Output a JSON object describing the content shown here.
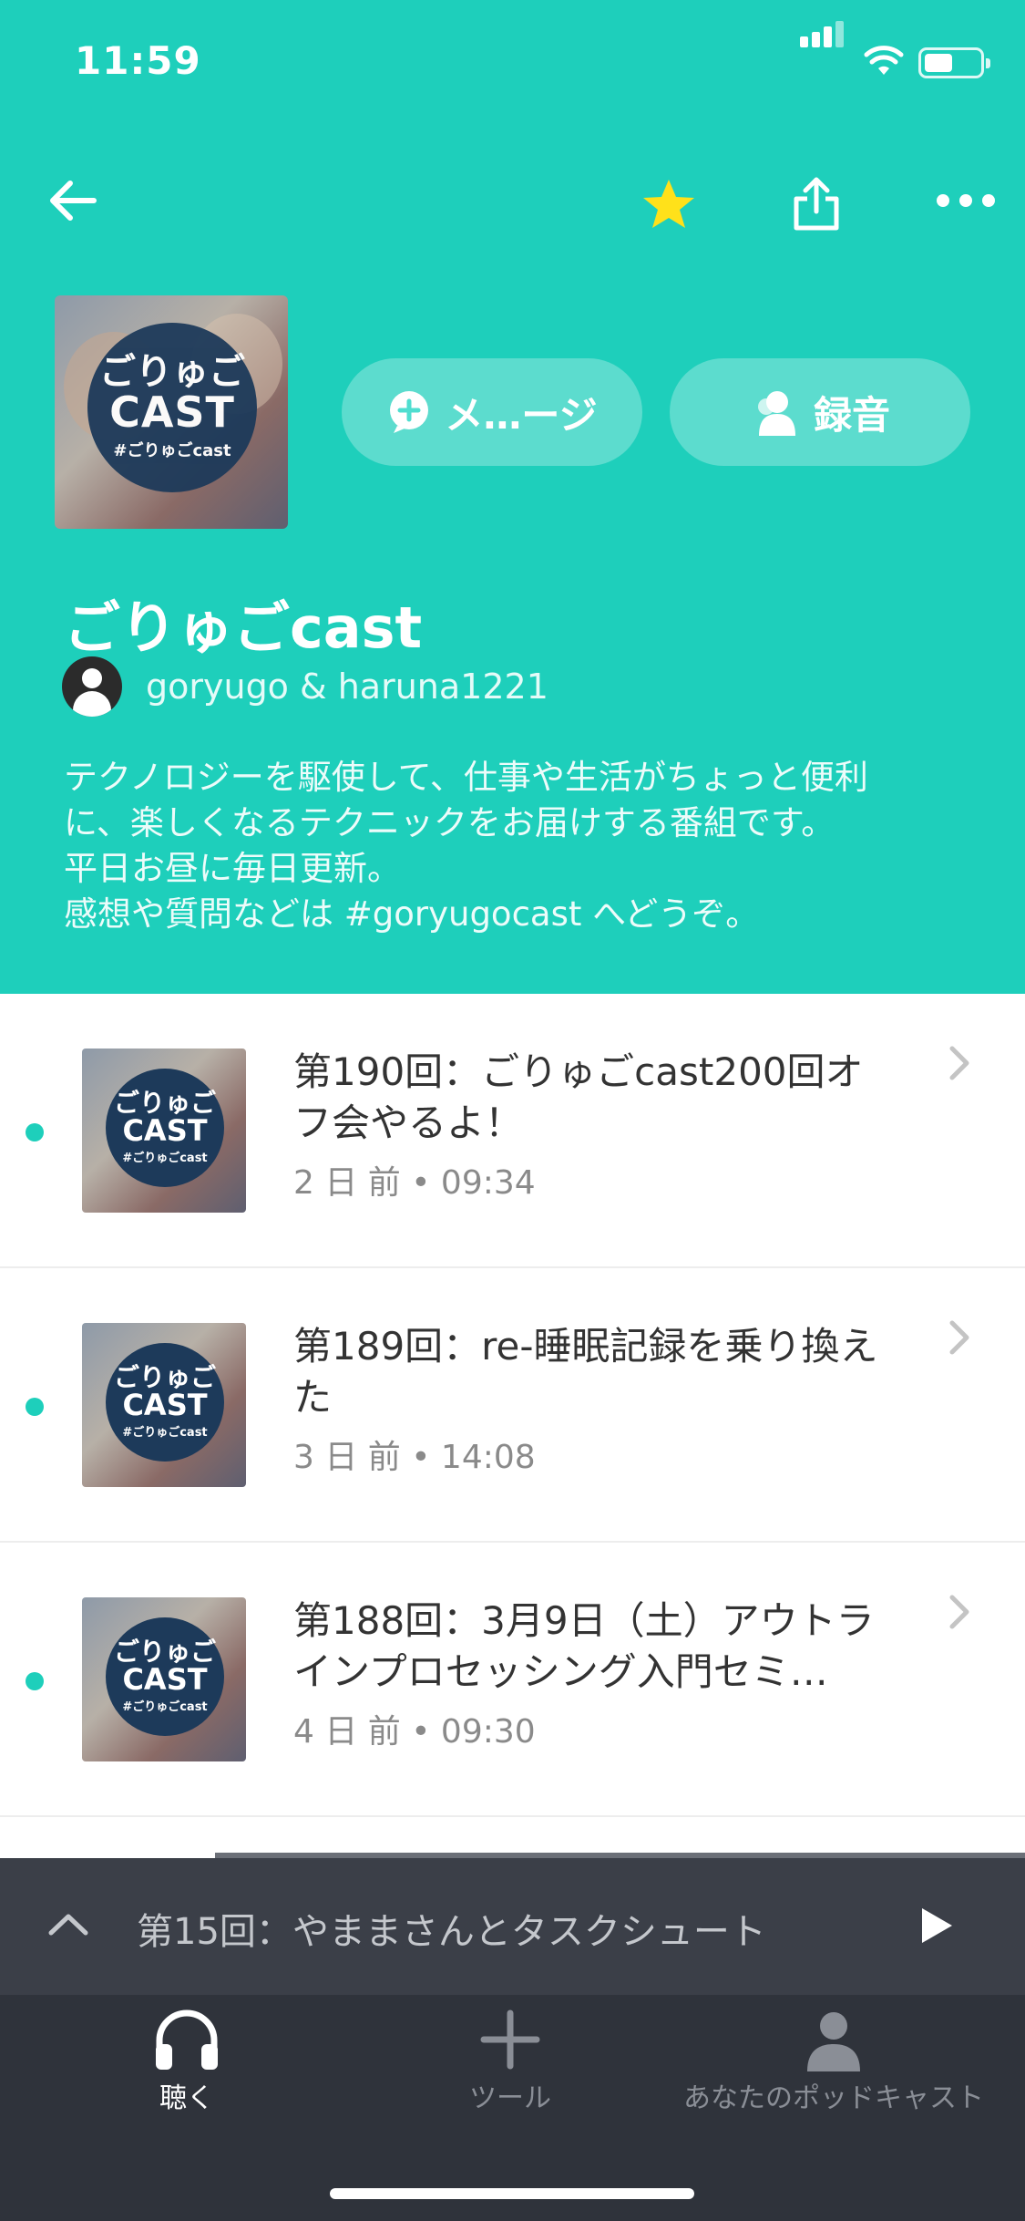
{
  "status_bar": {
    "time": "11:59"
  },
  "colors": {
    "accent": "#1ecfbb",
    "star": "#ffe11a",
    "player_bg": "#3b3f48",
    "tabbar_bg": "#2f333b"
  },
  "header": {
    "back_icon": "back-arrow-icon",
    "favorite_icon": "star-icon",
    "share_icon": "share-icon",
    "more_icon": "more-horizontal-icon"
  },
  "podcast": {
    "cover_text_line1": "ごりゅご",
    "cover_text_line2": "CAST",
    "cover_text_line3": "#ごりゅごcast",
    "title": "ごりゅごcast",
    "owners": "goryugo & haruna1221",
    "description_lines": [
      "テクノロジーを駆使して、仕事や生活がちょっと便利",
      "に、楽しくなるテクニックをお届けする番組です。",
      "平日お昼に毎日更新。",
      "感想や質問などは #goryugocast へどうぞ。"
    ]
  },
  "actions": {
    "message_label": "メ…ージ",
    "record_label": "録音"
  },
  "episodes": [
    {
      "title_line1": "第190回：ごりゅごcast200回オ",
      "title_line2": "フ会やるよ！",
      "meta": "2 日 前 • 09:34"
    },
    {
      "title_line1": "第189回：re-睡眠記録を乗り換え",
      "title_line2": "た",
      "meta": "3 日 前 • 14:08"
    },
    {
      "title_line1": "第188回：3月9日（土）アウトラ",
      "title_line2": "インプロセッシング入門セミ…",
      "meta": "4 日 前 • 09:30"
    }
  ],
  "player": {
    "now_playing": "第15回：やままさんとタスクシュート",
    "progress": 0.21
  },
  "tabs": [
    {
      "label": "聴く",
      "icon": "headphones-icon",
      "active": true
    },
    {
      "label": "ツール",
      "icon": "plus-icon",
      "active": false
    },
    {
      "label": "あなたのポッドキャスト",
      "icon": "person-icon",
      "active": false
    }
  ]
}
